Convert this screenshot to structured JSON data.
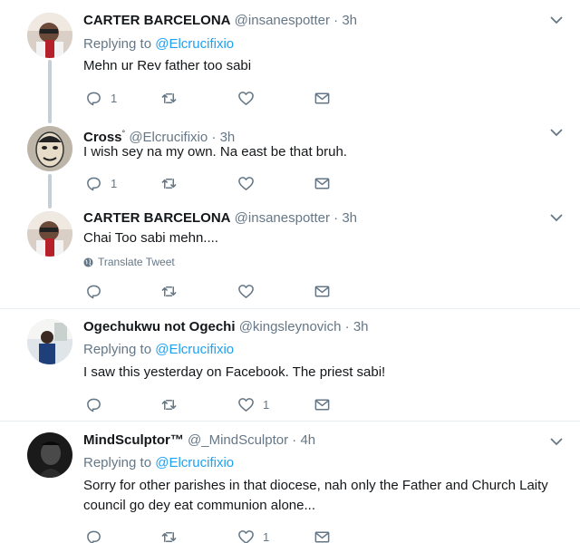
{
  "tweets": [
    {
      "name": "CARTER BARCELONA",
      "handle": "@insanespotter",
      "dot": "·",
      "time": "3h",
      "reply_prefix": "Replying to",
      "reply_to": "@Elcrucifixio",
      "text": "Mehn ur Rev father too sabi",
      "reply_count": "1",
      "like_count": ""
    },
    {
      "name": "Cross",
      "verified_mark": "°",
      "handle": "@Elcrucifixio",
      "dot": "·",
      "time": "3h",
      "text": "I wish sey na my own. Na east be that bruh.",
      "reply_count": "1",
      "like_count": ""
    },
    {
      "name": "CARTER BARCELONA",
      "handle": "@insanespotter",
      "dot": "·",
      "time": "3h",
      "text": "Chai Too sabi mehn....",
      "translate_label": "Translate Tweet",
      "reply_count": "",
      "like_count": ""
    },
    {
      "name": "Ogechukwu not Ogechi",
      "handle": "@kingsleynovich",
      "dot": "·",
      "time": "3h",
      "reply_prefix": "Replying to",
      "reply_to": "@Elcrucifixio",
      "text": "I saw this yesterday on Facebook. The priest sabi!",
      "reply_count": "",
      "like_count": "1"
    },
    {
      "name": "MindSculptor™",
      "handle": "@_MindSculptor",
      "dot": "·",
      "time": "4h",
      "reply_prefix": "Replying to",
      "reply_to": "@Elcrucifixio",
      "text": "Sorry for other parishes in that diocese, nah only the Father and Church Laity council go dey eat communion alone...",
      "reply_count": "",
      "like_count": "1"
    }
  ],
  "icons": {
    "reply": "reply-icon",
    "retweet": "retweet-icon",
    "like": "heart-icon",
    "message": "envelope-icon",
    "more": "chevron-down-icon",
    "globe": "globe-icon"
  },
  "colors": {
    "link": "#1da1f2",
    "muted": "#657786",
    "text": "#14171a",
    "thread_line": "#c4cfd6",
    "divider": "#e6ecf0"
  }
}
